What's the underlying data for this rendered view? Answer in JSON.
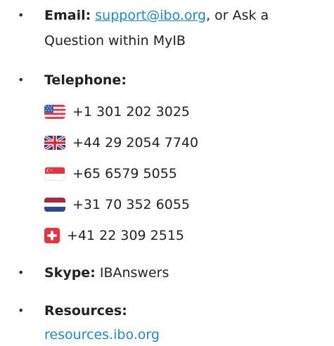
{
  "contact": {
    "email": {
      "label": "Email:",
      "address": "support@ibo.org",
      "suffix": ", or Ask a",
      "continuation": "Question within MyIB"
    },
    "telephone": {
      "label": "Telephone:",
      "numbers": [
        {
          "flag": "us-flag-icon",
          "number": "+1 301 202 3025"
        },
        {
          "flag": "uk-flag-icon",
          "number": "+44 29 2054 7740"
        },
        {
          "flag": "singapore-flag-icon",
          "number": "+65 6579 5055"
        },
        {
          "flag": "netherlands-flag-icon",
          "number": "+31 70 352 6055"
        },
        {
          "flag": "switzerland-flag-icon",
          "number": "+41 22 309 2515"
        }
      ]
    },
    "skype": {
      "label": "Skype:",
      "value": "IBAnswers"
    },
    "resources": {
      "label": "Resources:",
      "link": "resources.ibo.org"
    }
  },
  "colors": {
    "link": "#1a8ad1",
    "text": "#222222"
  }
}
